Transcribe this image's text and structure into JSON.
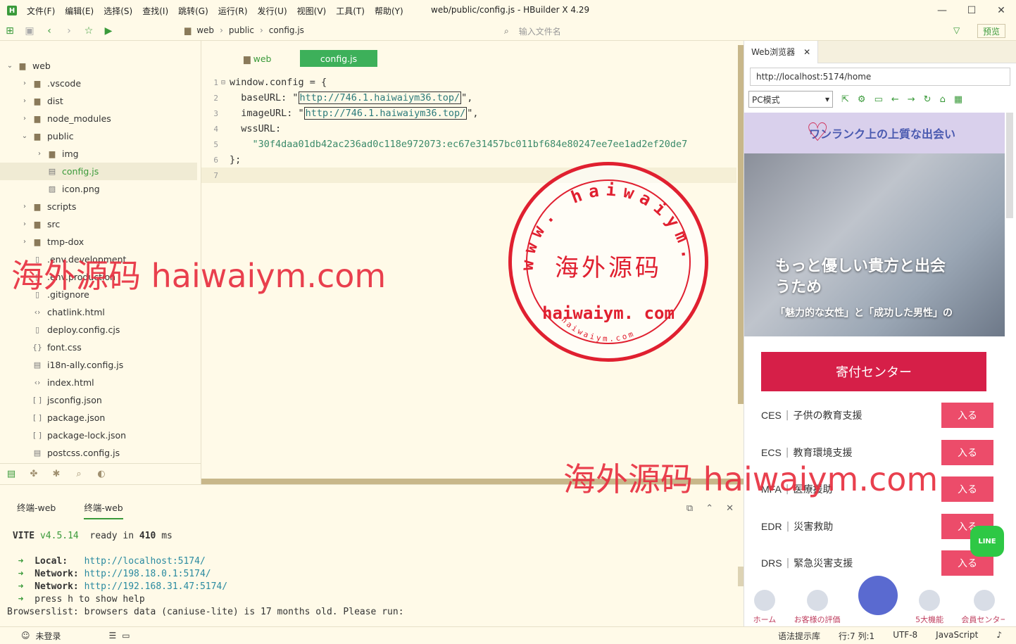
{
  "app": {
    "logo": "H",
    "title": "web/public/config.js - HBuilder X 4.29",
    "menu": [
      "文件(F)",
      "编辑(E)",
      "选择(S)",
      "查找(I)",
      "跳转(G)",
      "运行(R)",
      "发行(U)",
      "视图(V)",
      "工具(T)",
      "帮助(Y)"
    ],
    "window_controls": [
      "—",
      "☐",
      "✕"
    ]
  },
  "toolbar": {
    "breadcrumb": [
      "web",
      "public",
      "config.js"
    ],
    "file_input_placeholder": "输入文件名",
    "preview_label": "预览"
  },
  "sidebar": {
    "items": [
      {
        "label": "web",
        "icon": "folder-icon",
        "chevron": "⌄"
      },
      {
        "label": ".vscode",
        "icon": "folder-icon",
        "chevron": "›"
      },
      {
        "label": "dist",
        "icon": "folder-icon",
        "chevron": "›"
      },
      {
        "label": "node_modules",
        "icon": "folder-icon",
        "chevron": "›"
      },
      {
        "label": "public",
        "icon": "folder-icon",
        "chevron": "⌄"
      },
      {
        "label": "img",
        "icon": "folder-icon",
        "chevron": "›"
      },
      {
        "label": "config.js",
        "icon": "js-file-icon",
        "chevron": ""
      },
      {
        "label": "icon.png",
        "icon": "image-file-icon",
        "chevron": ""
      },
      {
        "label": "scripts",
        "icon": "folder-icon",
        "chevron": "›"
      },
      {
        "label": "src",
        "icon": "folder-icon",
        "chevron": "›"
      },
      {
        "label": "tmp-dox",
        "icon": "folder-icon",
        "chevron": "›"
      },
      {
        "label": ".env.development",
        "icon": "file-icon",
        "chevron": ""
      },
      {
        "label": ".env.production",
        "icon": "file-icon",
        "chevron": ""
      },
      {
        "label": ".gitignore",
        "icon": "file-icon",
        "chevron": ""
      },
      {
        "label": "chatlink.html",
        "icon": "html-file-icon",
        "chevron": ""
      },
      {
        "label": "deploy.config.cjs",
        "icon": "file-icon",
        "chevron": ""
      },
      {
        "label": "font.css",
        "icon": "css-file-icon",
        "chevron": ""
      },
      {
        "label": "i18n-ally.config.js",
        "icon": "js-file-icon",
        "chevron": ""
      },
      {
        "label": "index.html",
        "icon": "html-file-icon",
        "chevron": ""
      },
      {
        "label": "jsconfig.json",
        "icon": "json-file-icon",
        "chevron": ""
      },
      {
        "label": "package.json",
        "icon": "json-file-icon",
        "chevron": ""
      },
      {
        "label": "package-lock.json",
        "icon": "json-file-icon",
        "chevron": ""
      },
      {
        "label": "postcss.config.js",
        "icon": "js-file-icon",
        "chevron": ""
      }
    ]
  },
  "editor": {
    "tabs": [
      "web",
      "config.js"
    ],
    "lines": [
      {
        "n": "1",
        "pre": "window.config = {",
        "url": "",
        "post": ""
      },
      {
        "n": "2",
        "pre": "  baseURL: \"",
        "url": "http://746.1.haiwaiym36.top/",
        "post": "\","
      },
      {
        "n": "3",
        "pre": "  imageURL: \"",
        "url": "http://746.1.haiwaiym36.top/",
        "post": "\","
      },
      {
        "n": "4",
        "pre": "  wssURL:",
        "url": "",
        "post": ""
      },
      {
        "n": "5",
        "pre": "    \"30f4daa01db42ac236ad0c118e972073:ec67e31457bc011bf684e80247ee7ee1ad2ef20de7",
        "url": "",
        "post": ""
      },
      {
        "n": "6",
        "pre": "};",
        "url": "",
        "post": ""
      },
      {
        "n": "7",
        "pre": "",
        "url": "",
        "post": ""
      }
    ]
  },
  "terminal": {
    "tabs": [
      "终端-web",
      "终端-web"
    ],
    "vite_line": {
      "name": "VITE",
      "version": "v4.5.14",
      "ready": "ready in",
      "ms": "410",
      "unit": "ms"
    },
    "local_label": "Local:",
    "local_url": "http://localhost:5174/",
    "network1_label": "Network:",
    "network1_url": "http://198.18.0.1:5174/",
    "network2_label": "Network:",
    "network2_url": "http://192.168.31.47:5174/",
    "help_line": "press h to show help",
    "browserslist": "Browserslist: browsers data (caniuse-lite) is 17 months old. Please run:"
  },
  "status": {
    "login": "未登录",
    "hint": "语法提示库",
    "position": "行:7  列:1",
    "encoding": "UTF-8",
    "language": "JavaScript"
  },
  "browser": {
    "tab_label": "Web浏览器",
    "url": "http://localhost:5174/home",
    "mode": "PC模式",
    "header": "ワンランク上の上質な出会い",
    "hero_line1": "もっと優しい貴方と出会",
    "hero_line2": "うため",
    "hero_line3": "「魅力的な女性」と「成功した男性」の",
    "donate_label": "寄付センター",
    "items": [
      {
        "code": "CES",
        "desc": "子供の教育支援",
        "btn": "入る"
      },
      {
        "code": "ECS",
        "desc": "教育環境支援",
        "btn": "入る"
      },
      {
        "code": "MFA",
        "desc": "医療援助",
        "btn": "入る"
      },
      {
        "code": "EDR",
        "desc": "災害救助",
        "btn": "入る"
      },
      {
        "code": "DRS",
        "desc": "緊急災害支援",
        "btn": "入る"
      }
    ],
    "nav": [
      "ホーム",
      "お客様の評価",
      "",
      "5大機能",
      "会員センター"
    ],
    "line_badge": "LINE"
  },
  "watermark": {
    "text": "海外源码 haiwaiym.com",
    "stamp_main": "海外源码",
    "stamp_domain": "haiwaiym. com",
    "stamp_ring": "www. haiwaiym. com",
    "stamp_small": "haiwaiym.com"
  },
  "colors": {
    "accent": "#3a9a3a",
    "bg": "#fffae8",
    "watermark": "#e02030",
    "donate": "#d61f48"
  }
}
